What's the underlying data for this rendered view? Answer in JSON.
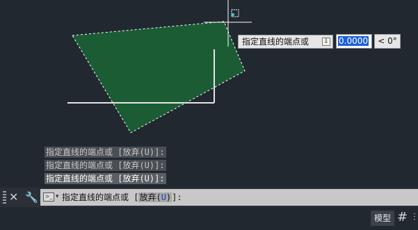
{
  "canvas": {
    "polygon_fill": "#1b5c35",
    "background": "#212830"
  },
  "dynamic_input": {
    "prompt": "指定直线的端点或",
    "menu_arrow": "⇩",
    "value": "0.0000",
    "angle": "< 0°"
  },
  "history": [
    "指定直线的端点或 [放弃(U)]:",
    "指定直线的端点或 [放弃(U)]:",
    "指定直线的端点或 [放弃(U)]:"
  ],
  "command_line": {
    "close_icon": "close-icon",
    "customize_icon": "wrench-icon",
    "prompt": "指定直线的端点或 [",
    "option_label": "放弃(",
    "option_key": "U",
    "option_close": ")",
    "suffix": "]:"
  },
  "status_bar": {
    "model_tab": "模型",
    "grid_icon": "grid-icon"
  }
}
